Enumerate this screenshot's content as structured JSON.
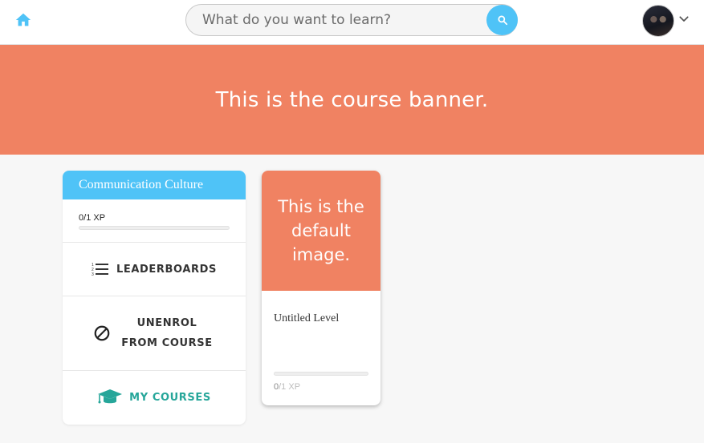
{
  "header": {
    "home_icon": "home-icon",
    "search": {
      "placeholder": "What do you want to learn?",
      "value": ""
    },
    "search_icon": "search-icon",
    "avatar": "user-avatar",
    "chevron_icon": "chevron-down-icon"
  },
  "banner": {
    "text": "This is the course banner."
  },
  "sidebar": {
    "course_title": "Communication Culture",
    "xp": {
      "current": "0",
      "total": "1",
      "unit": "XP",
      "progress": 0
    },
    "items": [
      {
        "label": "LEADERBOARDS",
        "icon": "list-icon"
      },
      {
        "label": "UNENROL FROM COURSE",
        "icon": "block-icon"
      },
      {
        "label": "MY COURSES",
        "icon": "graduation-cap-icon"
      }
    ]
  },
  "levels": [
    {
      "image_text": "This is the default image.",
      "title": "Untitled Level",
      "xp_current": "0",
      "xp_total": "/1 XP",
      "progress": 0
    }
  ],
  "colors": {
    "accent": "#4fc3f7",
    "banner": "#f08262",
    "teal": "#26a69a"
  }
}
